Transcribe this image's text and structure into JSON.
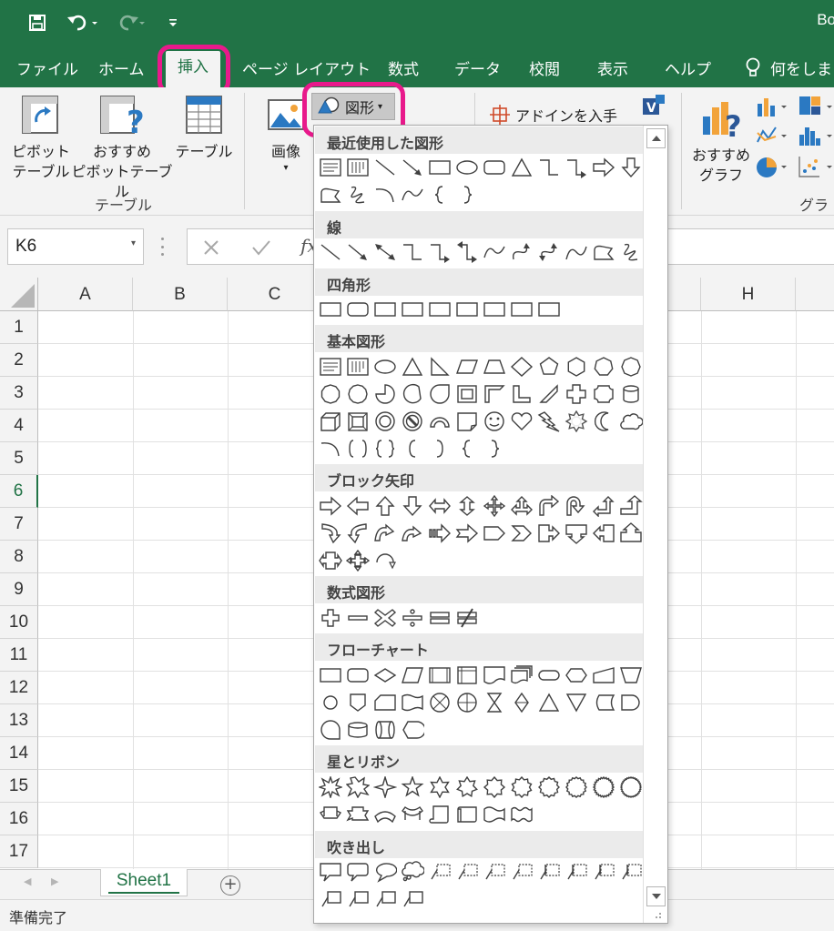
{
  "app": {
    "window_title": "Bo",
    "accent_color": "#217346",
    "highlight_color": "#e8198b"
  },
  "quick_access": {
    "save_icon": "save-icon",
    "undo_icon": "undo-icon",
    "redo_icon": "redo-icon",
    "customize_icon": "customize-qat-icon"
  },
  "tabs": [
    "ファイル",
    "ホーム",
    "挿入",
    "ページ レイアウト",
    "数式",
    "データ",
    "校閲",
    "表示",
    "ヘルプ"
  ],
  "tell_me": "何をしま",
  "ribbon": {
    "pivot_table": [
      "ピボット",
      "テーブル"
    ],
    "recommended_pivot": [
      "おすすめ",
      "ピボットテーブル"
    ],
    "table": "テーブル",
    "group_table": "テーブル",
    "image": "画像",
    "shapes_button": "図形",
    "addin": "アドインを入手",
    "recommended_chart": [
      "おすすめ",
      "グラフ"
    ],
    "group_chart": "グラフ"
  },
  "formula_bar": {
    "name_box": "K6",
    "fx": "fx"
  },
  "grid": {
    "columns": [
      "A",
      "B",
      "C",
      "H"
    ],
    "rows": [
      "1",
      "2",
      "3",
      "4",
      "5",
      "6",
      "7",
      "8",
      "9",
      "10",
      "11",
      "12",
      "13",
      "14",
      "15",
      "16",
      "17"
    ],
    "active_row": "6"
  },
  "sheet_tab": "Sheet1",
  "status": "準備完了",
  "shapes_gallery": {
    "categories": [
      {
        "name": "最近使用した図形",
        "shapes": [
          "text-box",
          "vertical-text-box",
          "line",
          "arrow",
          "rectangle",
          "oval",
          "rounded-rectangle",
          "triangle",
          "elbow-connector",
          "elbow-arrow",
          "right-arrow",
          "down-arrow",
          "freeform",
          "scribble",
          "arc",
          "curve",
          "left-brace",
          "right-brace"
        ]
      },
      {
        "name": "線",
        "shapes": [
          "line",
          "arrow",
          "double-arrow",
          "elbow",
          "elbow-arrow",
          "elbow-double-arrow",
          "curve",
          "curved-arrow",
          "curved-double-arrow",
          "curve-2",
          "freeform",
          "scribble"
        ]
      },
      {
        "name": "四角形",
        "shapes": [
          "rectangle",
          "rounded-rectangle",
          "snip-single",
          "snip-same-side",
          "snip-diagonal",
          "snip-round",
          "round-single",
          "round-same-side",
          "round-diagonal"
        ]
      },
      {
        "name": "基本図形",
        "shapes": [
          "text-box",
          "vertical-text-box",
          "oval",
          "triangle",
          "right-triangle",
          "parallelogram",
          "trapezoid",
          "diamond",
          "pentagon",
          "hexagon",
          "heptagon",
          "octagon",
          "decagon",
          "dodecagon",
          "pie",
          "chord",
          "teardrop",
          "frame",
          "half-frame",
          "l-shape",
          "diagonal-stripe",
          "cross",
          "plaque",
          "can",
          "cube",
          "bevel",
          "donut",
          "no-symbol",
          "block-arc",
          "folded-corner",
          "smiley",
          "heart",
          "lightning",
          "sun",
          "moon",
          "cloud",
          "arc",
          "double-bracket",
          "double-brace",
          "left-bracket",
          "right-bracket",
          "left-brace",
          "right-brace"
        ]
      },
      {
        "name": "ブロック矢印",
        "shapes": [
          "right-arrow",
          "left-arrow",
          "up-arrow",
          "down-arrow",
          "left-right-arrow",
          "up-down-arrow",
          "quad-arrow",
          "left-right-up-arrow",
          "bent-arrow",
          "u-turn-arrow",
          "left-up-arrow",
          "bent-up-arrow",
          "curved-right-arrow",
          "curved-left-arrow",
          "curved-up-arrow",
          "curved-down-arrow",
          "striped-right-arrow",
          "notched-right-arrow",
          "pentagon-arrow",
          "chevron",
          "right-arrow-callout",
          "down-arrow-callout",
          "left-arrow-callout",
          "up-arrow-callout",
          "left-right-arrow-callout",
          "quad-arrow-callout",
          "circular-arrow"
        ]
      },
      {
        "name": "数式図形",
        "shapes": [
          "plus",
          "minus",
          "multiply",
          "division",
          "equal",
          "not-equal"
        ]
      },
      {
        "name": "フローチャート",
        "shapes": [
          "process",
          "alternate-process",
          "decision",
          "data",
          "predefined-process",
          "internal-storage",
          "document",
          "multidocument",
          "terminator",
          "preparation",
          "manual-input",
          "manual-operation",
          "connector",
          "off-page-connector",
          "card",
          "punched-tape",
          "summing-junction",
          "or",
          "collate",
          "sort",
          "extract",
          "merge",
          "stored-data",
          "delay",
          "sequential-access",
          "magnetic-disk",
          "direct-access",
          "display"
        ]
      },
      {
        "name": "星とリボン",
        "shapes": [
          "explosion-1",
          "explosion-2",
          "star-4",
          "star-5",
          "star-6",
          "star-7",
          "star-8",
          "star-10",
          "star-12",
          "star-16",
          "star-24",
          "star-32",
          "ribbon-up",
          "ribbon-down",
          "curved-ribbon-up",
          "curved-ribbon-down",
          "scroll-vertical",
          "scroll-horizontal",
          "wave",
          "double-wave"
        ]
      },
      {
        "name": "吹き出し",
        "shapes": [
          "rect-callout",
          "rounded-callout",
          "oval-callout",
          "cloud-callout",
          "line-callout-1",
          "line-callout-2",
          "line-callout-3",
          "line-callout-4",
          "accent-callout-1",
          "accent-callout-2",
          "accent-callout-3",
          "accent-callout-4",
          "border-callout-1",
          "border-callout-2",
          "border-callout-3",
          "border-callout-4"
        ]
      }
    ]
  }
}
